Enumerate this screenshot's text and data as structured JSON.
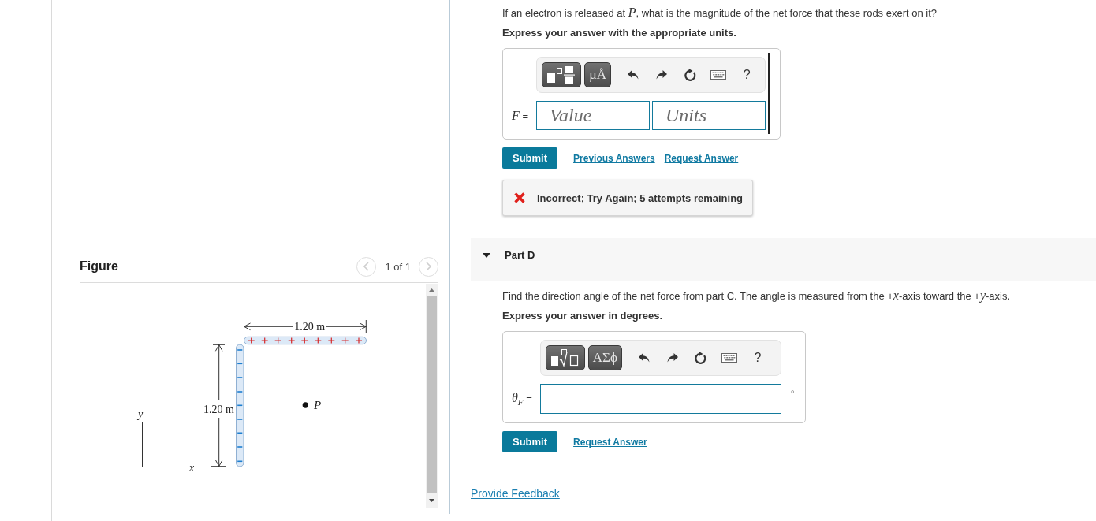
{
  "figure_panel": {
    "title": "Figure",
    "pager": {
      "label": "1 of 1",
      "buttons": [
        {
          "kind": "previous",
          "disabled": true
        },
        {
          "kind": "next",
          "disabled": true
        }
      ]
    },
    "figure": {
      "width_label": "1.20 m",
      "height_label": "1.20 m",
      "point_label": "P",
      "x_axis_label": "x",
      "y_axis_label": "y"
    }
  },
  "parts": [
    {
      "prompt": "If an electron is released at *P*, what is the magnitude of the net force that these rods exert on it?",
      "instruction": "Express your answer with the appropriate units.",
      "answer": {
        "kind": "value_units",
        "label": "*F* =",
        "toolbar": [
          {
            "kind": "fraction"
          },
          {
            "kind": "symbols",
            "label": "µÅ"
          },
          {
            "kind": "undo"
          },
          {
            "kind": "redo"
          },
          {
            "kind": "reset"
          },
          {
            "kind": "keyboard"
          },
          {
            "kind": "help",
            "label": "?"
          }
        ],
        "fields": [
          {
            "placeholder": "Value"
          },
          {
            "placeholder": "Units"
          }
        ]
      },
      "submit": "Submit",
      "links": [
        "Previous Answers",
        "Request Answer"
      ],
      "feedback": {
        "kind": "incorrect",
        "message": "Incorrect; Try Again; 5 attempts remaining"
      }
    },
    {
      "header": {
        "title": "Part D",
        "expanded": true
      },
      "prompt": "Find the direction angle of the net force from part C. The angle is measured from the +*x*-axis toward the +*y*-axis.",
      "instruction": "Express your answer in degrees.",
      "answer": {
        "kind": "number",
        "label": "*θ*$_{F}$ =",
        "toolbar": [
          {
            "kind": "radical"
          },
          {
            "kind": "symbols",
            "label": "ΑΣϕ"
          },
          {
            "kind": "undo"
          },
          {
            "kind": "redo"
          },
          {
            "kind": "reset"
          },
          {
            "kind": "keyboard"
          },
          {
            "kind": "help",
            "label": "?"
          }
        ],
        "unit": "°"
      },
      "submit": "Submit",
      "links": [
        "Request Answer"
      ]
    }
  ],
  "feedback_link": "Provide Feedback"
}
